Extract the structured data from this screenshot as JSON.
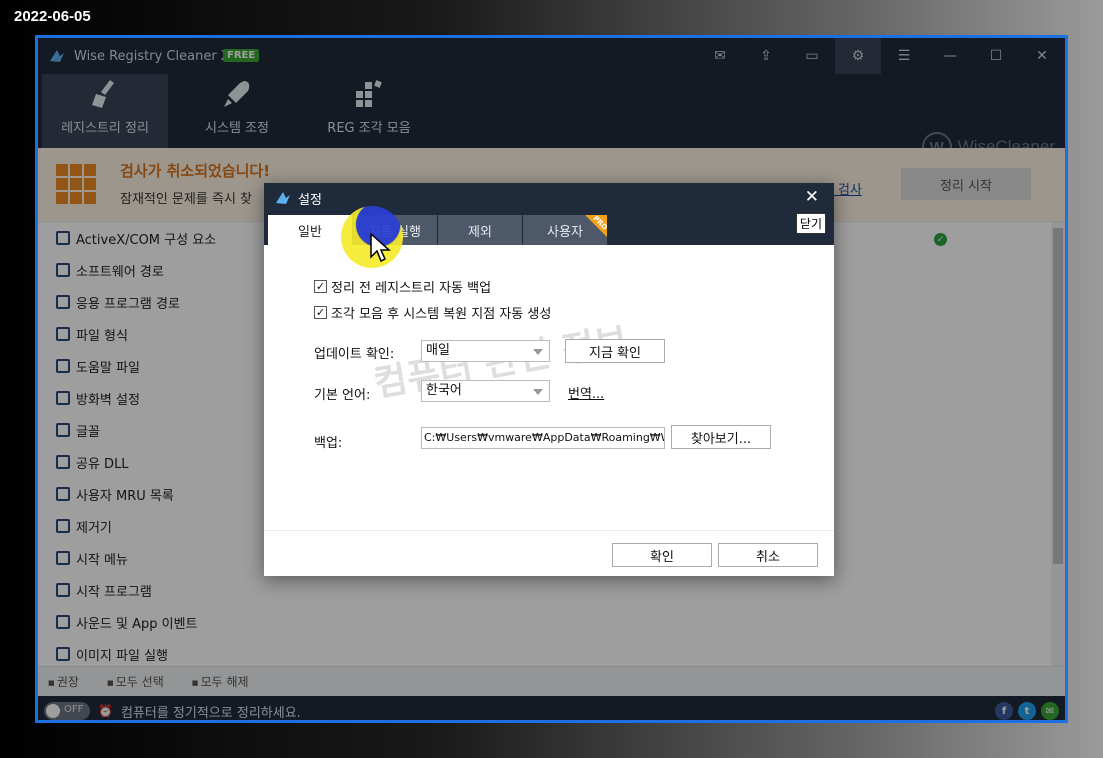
{
  "date_stamp": "2022-06-05",
  "app": {
    "title": "Wise Registry Cleaner X",
    "badge": "FREE",
    "brand": "WiseCleaner",
    "brand_mark": "W"
  },
  "toolbar": {
    "tabs": [
      {
        "label": "레지스트리 정리",
        "icon": "broom-icon"
      },
      {
        "label": "시스템 조정",
        "icon": "rocket-icon"
      },
      {
        "label": "REG 조각 모음",
        "icon": "defrag-blocks-icon"
      }
    ]
  },
  "banner": {
    "title": "검사가 취소되었습니다!",
    "subtitle": "잠재적인 문제를 즉시 찾",
    "rescan": "다시 검사",
    "clean_button": "정리 시작"
  },
  "categories": [
    "ActiveX/COM 구성 요소",
    "소프트웨어 경로",
    "응용 프로그램 경로",
    "파일 형식",
    "도움말 파일",
    "방화벽 설정",
    "글꼴",
    "공유 DLL",
    "사용자 MRU 목록",
    "제거기",
    "시작 메뉴",
    "시작 프로그램",
    "사운드 및 App 이벤트",
    "이미지 파일 실행"
  ],
  "bottom_links": [
    "권장",
    "모두 선택",
    "모두 해제"
  ],
  "status": {
    "toggle": "OFF",
    "message": "컴퓨터를 정기적으로 정리하세요."
  },
  "dialog": {
    "title": "설정",
    "close_tooltip": "닫기",
    "tabs": [
      "일반",
      "자동 실행",
      "제외",
      "사용자"
    ],
    "pro_label": "PRO",
    "checkbox1": "정리 전 레지스트리 자동 백업",
    "checkbox2": "조각 모음 후 시스템 복원 지점 자동 생성",
    "update_label": "업데이트 확인:",
    "update_value": "매일",
    "check_now": "지금 확인",
    "language_label": "기본 언어:",
    "language_value": "한국어",
    "translate_link": "번역...",
    "backup_label": "백업:",
    "backup_path": "C:₩Users₩vmware₩AppData₩Roaming₩Wise",
    "browse": "찾아보기...",
    "ok": "확인",
    "cancel": "취소"
  },
  "watermark": "컴퓨터 관련 정보"
}
